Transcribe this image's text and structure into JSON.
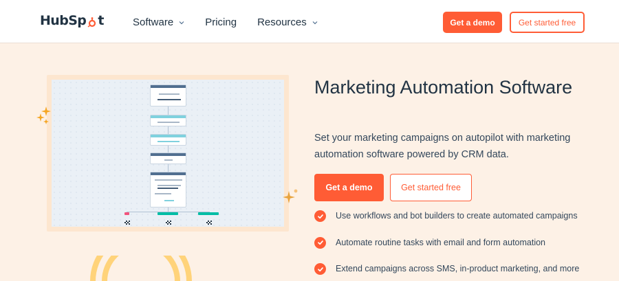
{
  "header": {
    "logo_text_left": "HubSp",
    "logo_text_right": "t",
    "nav": [
      {
        "label": "Software",
        "has_dropdown": true
      },
      {
        "label": "Pricing",
        "has_dropdown": false
      },
      {
        "label": "Resources",
        "has_dropdown": true
      }
    ],
    "demo_label": "Get a demo",
    "free_label": "Get started free"
  },
  "hero": {
    "title": "Marketing Automation Software",
    "subtitle": "Set your marketing campaigns on autopilot with marketing automation software powered by CRM data.",
    "demo_label": "Get a demo",
    "free_label": "Get started free",
    "features": [
      "Use workflows and bot builders to create automated campaigns",
      "Automate routine tasks with email and form automation",
      "Extend campaigns across SMS, in-product marketing, and more"
    ]
  },
  "colors": {
    "brand": "#ff5c35",
    "background": "#fdf1e6",
    "heading": "#213343"
  }
}
